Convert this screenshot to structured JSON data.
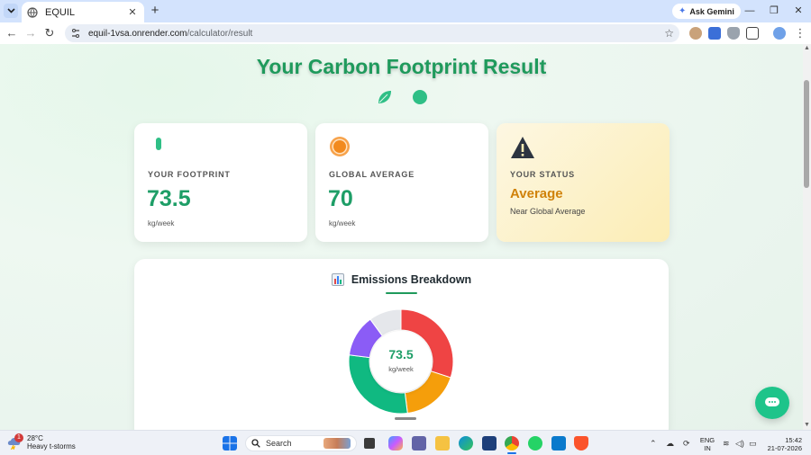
{
  "browser": {
    "tab_title": "EQUIL",
    "tab_close": "✕",
    "new_tab": "+",
    "ask_gemini": "Ask Gemini",
    "url_host": "equil-1vsa.onrender.com",
    "url_path": "/calculator/result",
    "window_controls": {
      "minimize": "—",
      "restore": "❐",
      "close": "✕"
    }
  },
  "page": {
    "title": "Your Carbon Footprint Result",
    "cards": {
      "footprint": {
        "label": "YOUR FOOTPRINT",
        "value": "73.5",
        "unit": "kg/week"
      },
      "global": {
        "label": "GLOBAL AVERAGE",
        "value": "70",
        "unit": "kg/week"
      },
      "status": {
        "label": "YOUR STATUS",
        "value": "Average",
        "description": "Near Global Average"
      }
    },
    "breakdown": {
      "title": "Emissions Breakdown",
      "center_value": "73.5",
      "center_unit": "kg/week"
    }
  },
  "chart_data": {
    "type": "pie",
    "variant": "donut",
    "center_label": "73.5",
    "center_unit": "kg/week",
    "slices": [
      {
        "value": 30,
        "color": "#ef4444"
      },
      {
        "value": 18,
        "color": "#f59e0b"
      },
      {
        "value": 29,
        "color": "#10b981"
      },
      {
        "value": 13,
        "color": "#8b5cf6"
      },
      {
        "value": 10,
        "color": "#e5e7eb"
      }
    ]
  },
  "taskbar": {
    "weather_temp": "28°C",
    "weather_desc": "Heavy t-storms",
    "weather_badge": "1",
    "search_label": "Search",
    "lang_line1": "ENG",
    "lang_line2": "IN",
    "time": "15:42",
    "date": "21-07-2026"
  },
  "colors": {
    "brand_green": "#1f9a5c",
    "value_green": "#1e9e67",
    "status_orange": "#d0820a"
  }
}
